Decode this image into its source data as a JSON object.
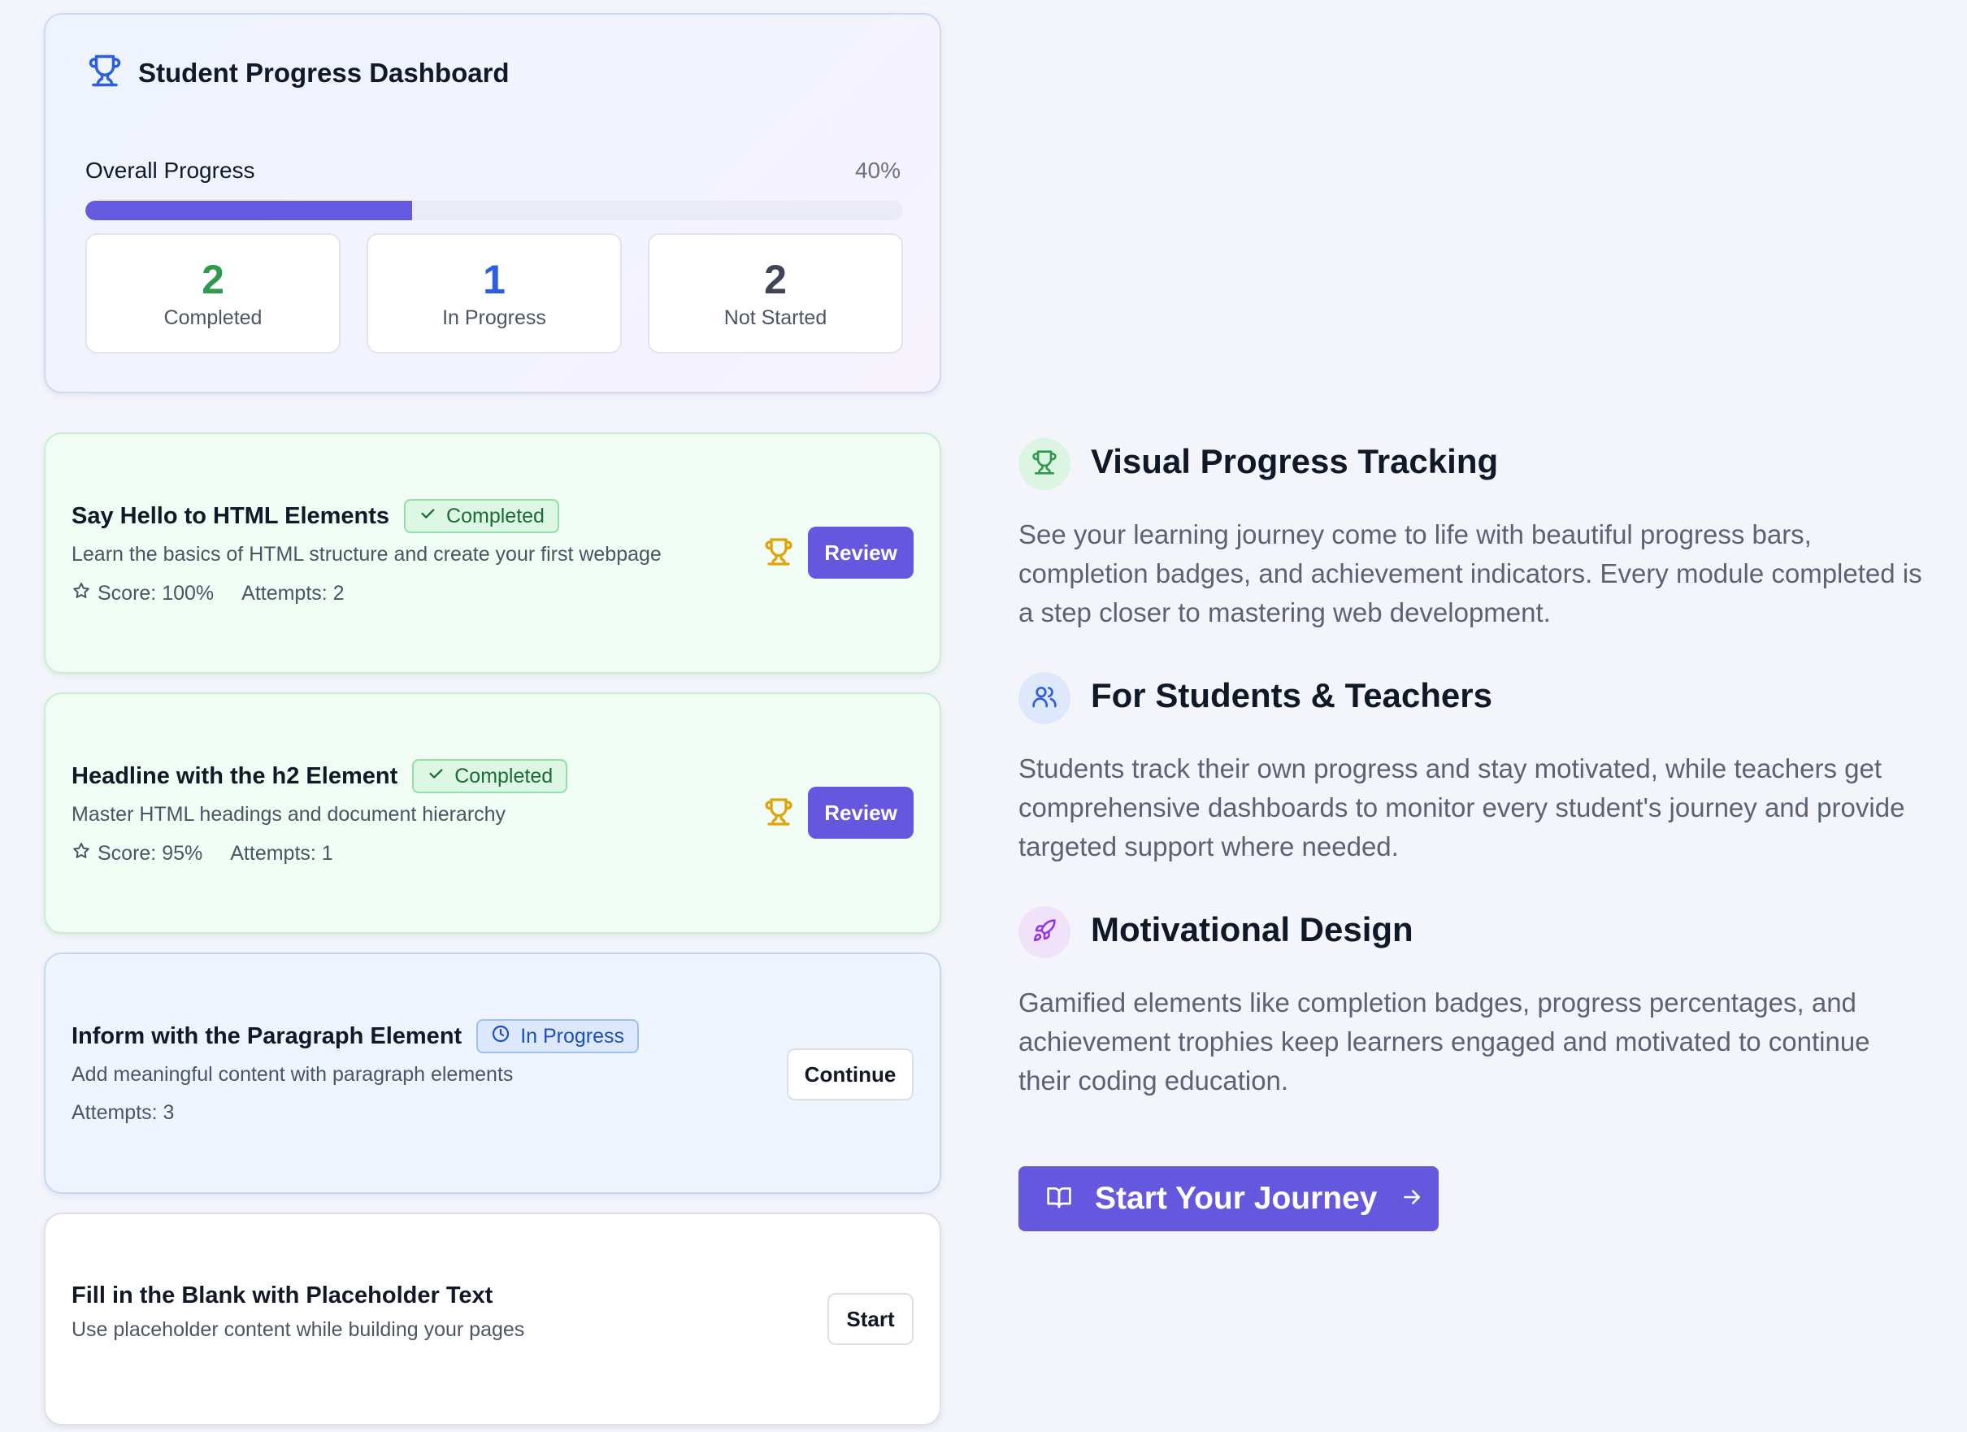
{
  "dashboard": {
    "title": "Student Progress Dashboard",
    "icon": "trophy-icon",
    "progress_label": "Overall Progress",
    "progress_text": "40%",
    "progress_value": 40,
    "stats": [
      {
        "number": "2",
        "label": "Completed",
        "color": "#2e9a4c"
      },
      {
        "number": "1",
        "label": "In Progress",
        "color": "#2b5fe0"
      },
      {
        "number": "2",
        "label": "Not Started",
        "color": "#3f4553"
      }
    ]
  },
  "modules": [
    {
      "title": "Say Hello to HTML Elements",
      "status": "Completed",
      "description": "Learn the basics of HTML structure and create your first webpage",
      "score": "Score: 100%",
      "attempts": "Attempts: 2",
      "button": "Review"
    },
    {
      "title": "Headline with the h2 Element",
      "status": "Completed",
      "description": "Master HTML headings and document hierarchy",
      "score": "Score: 95%",
      "attempts": "Attempts: 1",
      "button": "Review"
    },
    {
      "title": "Inform with the Paragraph Element",
      "status": "In Progress",
      "description": "Add meaningful content with paragraph elements",
      "attempts": "Attempts: 3",
      "button": "Continue"
    },
    {
      "title": "Fill in the Blank with Placeholder Text",
      "description": "Use placeholder content while building your pages",
      "button": "Start"
    }
  ],
  "features": [
    {
      "icon": "trophy-icon",
      "title": "Visual Progress Tracking",
      "text": "See your learning journey come to life with beautiful progress bars, completion badges, and achievement indicators. Every module completed is a step closer to mastering web development."
    },
    {
      "icon": "users-icon",
      "title": "For Students & Teachers",
      "text": "Students track their own progress and stay motivated, while teachers get comprehensive dashboards to monitor every student's journey and provide targeted support where needed."
    },
    {
      "icon": "rocket-icon",
      "title": "Motivational Design",
      "text": "Gamified elements like completion badges, progress percentages, and achievement trophies keep learners engaged and motivated to continue their coding education."
    }
  ],
  "cta": {
    "label": "Start Your Journey",
    "icon": "book-icon",
    "arrow_icon": "arrow-right-icon"
  },
  "colors": {
    "accent": "#6657df",
    "completed": "#2e9a4c",
    "in_progress": "#2b5fe0",
    "trophy": "#e0a40b"
  }
}
